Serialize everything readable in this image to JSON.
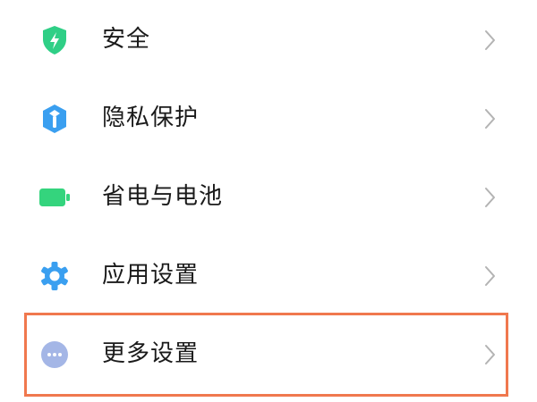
{
  "settings": {
    "items": [
      {
        "label": "安全",
        "icon": "shield-bolt-icon",
        "color": "#2fcf86"
      },
      {
        "label": "隐私保护",
        "icon": "privacy-shield-icon",
        "color": "#3a9ff0"
      },
      {
        "label": "省电与电池",
        "icon": "battery-icon",
        "color": "#34d47d"
      },
      {
        "label": "应用设置",
        "icon": "gear-icon",
        "color": "#3a9ff0"
      },
      {
        "label": "更多设置",
        "icon": "more-dots-icon",
        "color": "#a4b6e6"
      }
    ]
  },
  "colors": {
    "highlight_border": "#f0784e",
    "chevron": "#b3b3b3",
    "text": "#1a1a1a"
  }
}
